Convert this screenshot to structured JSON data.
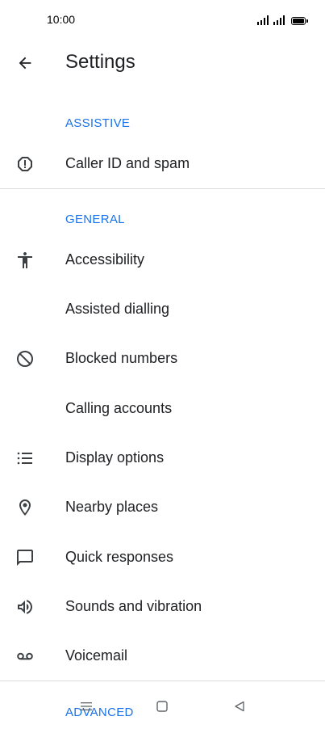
{
  "status_bar": {
    "time": "10:00"
  },
  "header": {
    "title": "Settings",
    "back_icon": "arrow-back-icon"
  },
  "sections": {
    "assistive": {
      "label": "ASSISTIVE"
    },
    "general": {
      "label": "GENERAL"
    },
    "advanced": {
      "label": "ADVANCED"
    }
  },
  "rows": {
    "caller_id": {
      "label": "Caller ID and spam",
      "icon": "spam-alert-icon"
    },
    "accessibility": {
      "label": "Accessibility",
      "icon": "accessibility-icon"
    },
    "assisted_dialling": {
      "label": "Assisted dialling"
    },
    "blocked_numbers": {
      "label": "Blocked numbers",
      "icon": "block-icon"
    },
    "calling_accounts": {
      "label": "Calling accounts"
    },
    "display_options": {
      "label": "Display options",
      "icon": "list-icon"
    },
    "nearby_places": {
      "label": "Nearby places",
      "icon": "location-pin-icon"
    },
    "quick_responses": {
      "label": "Quick responses",
      "icon": "chat-bubble-icon"
    },
    "sounds_vibration": {
      "label": "Sounds and vibration",
      "icon": "volume-icon"
    },
    "voicemail": {
      "label": "Voicemail",
      "icon": "voicemail-icon"
    }
  },
  "nav_bar": {
    "menu_icon": "menu-icon",
    "home_icon": "home-square-icon",
    "back_icon": "back-triangle-icon"
  },
  "colors": {
    "accent": "#1a73e8",
    "text": "#202124",
    "divider": "#dadce0",
    "icon": "#3c4043"
  }
}
